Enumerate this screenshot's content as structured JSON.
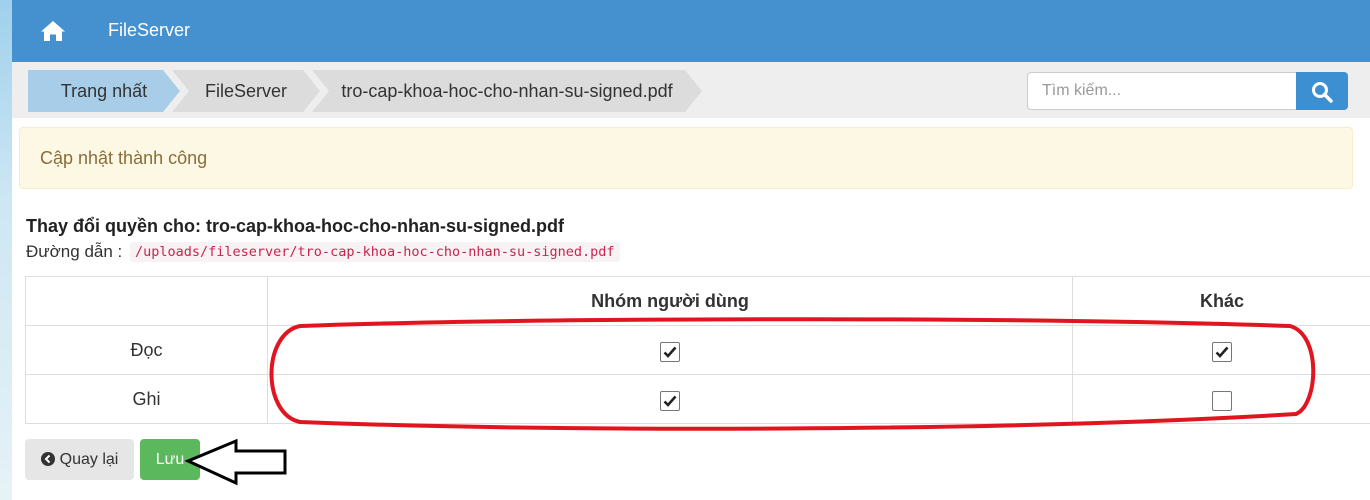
{
  "navbar": {
    "brand": "FileServer",
    "home_icon": "home-icon",
    "color": "#4590cf"
  },
  "breadcrumb": [
    {
      "label": "Trang nhất",
      "active": true
    },
    {
      "label": "FileServer",
      "active": false
    },
    {
      "label": "tro-cap-khoa-hoc-cho-nhan-su-signed.pdf",
      "active": false
    }
  ],
  "search": {
    "placeholder": "Tìm kiếm...",
    "value": "",
    "button_icon": "search-icon"
  },
  "alert": {
    "message": "Cập nhật thành công"
  },
  "permissions": {
    "title": "Thay đổi quyền cho: tro-cap-khoa-hoc-cho-nhan-su-signed.pdf",
    "path_label": "Đường dẫn :",
    "path": "/uploads/fileserver/tro-cap-khoa-hoc-cho-nhan-su-signed.pdf",
    "columns": [
      "",
      "Nhóm người dùng",
      "Khác"
    ],
    "rows": [
      {
        "label": "Đọc",
        "group": true,
        "other": true
      },
      {
        "label": "Ghi",
        "group": true,
        "other": false
      }
    ]
  },
  "actions": {
    "back_label": "Quay lại",
    "back_icon": "chevron-circle-left-icon",
    "save_label": "Lưu"
  },
  "colors": {
    "success": "#5cb85c",
    "alert_bg": "#fcf8e3",
    "annotation": "#e0151f"
  }
}
